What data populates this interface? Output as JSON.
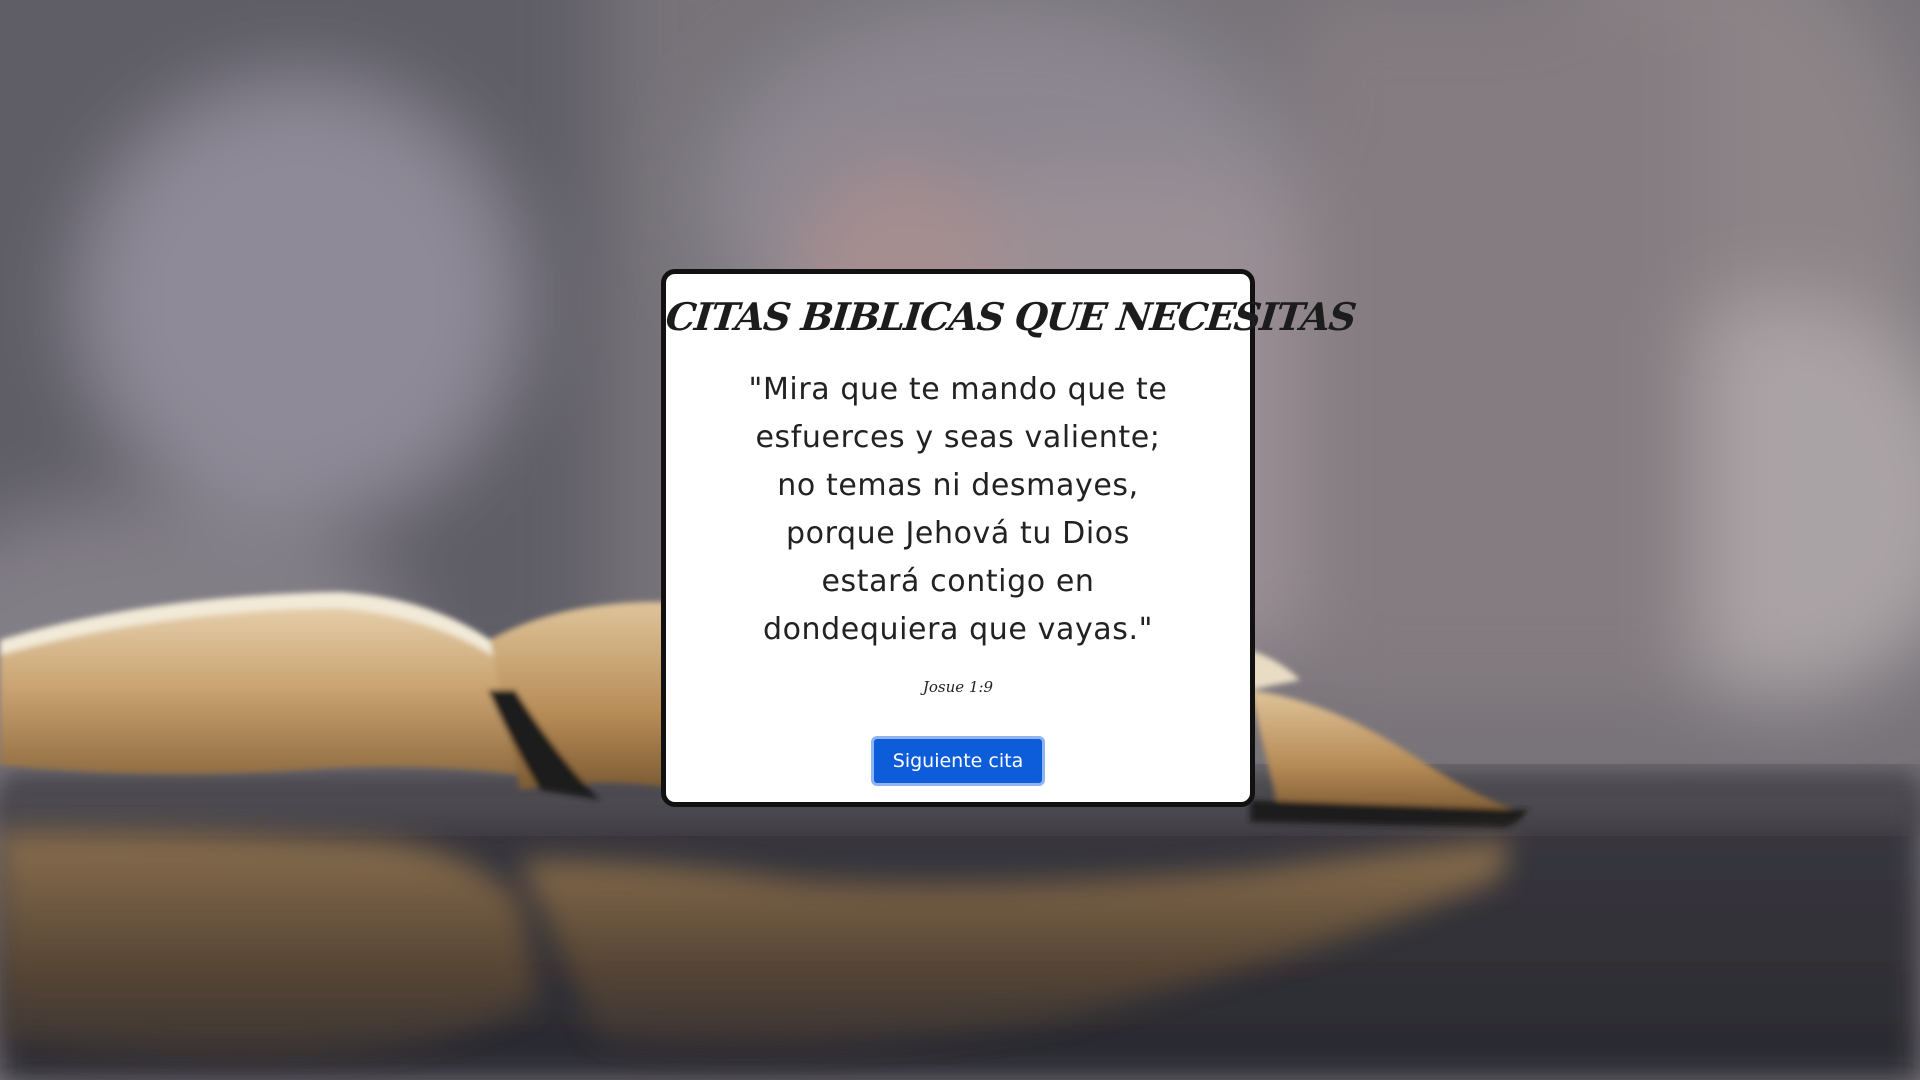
{
  "card": {
    "title": "CITAS BIBLICAS QUE NECESITAS",
    "quote_lines": [
      "\"Mira que te mando que te",
      "esfuerces y seas valiente;",
      "no temas ni desmayes,",
      "porque Jehová tu Dios",
      "estará contigo en",
      "dondequiera que vayas.\""
    ],
    "reference": "Josue 1:9",
    "next_button_label": "Siguiente cita"
  },
  "background": {
    "description_icon": "open-book-image"
  },
  "colors": {
    "button": "#0d5ddb",
    "button_border": "#8fb4f2",
    "card_border": "#111111",
    "card_bg": "#ffffff"
  }
}
